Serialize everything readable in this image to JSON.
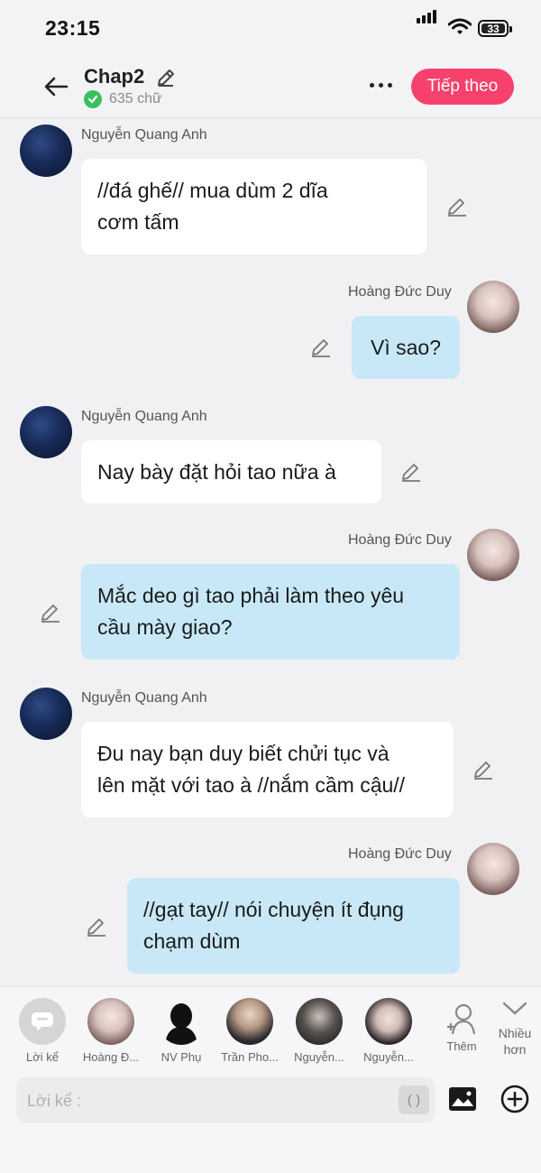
{
  "status_bar": {
    "time": "23:15",
    "battery": "33"
  },
  "header": {
    "title": "Chap2",
    "word_count": "635 chữ",
    "next_label": "Tiếp theo"
  },
  "messages": [
    {
      "sender": "Nguyễn Quang Anh",
      "side": "left",
      "line1": "//đá ghế// mua dùm 2 dĩa",
      "line2": "cơm tấm"
    },
    {
      "sender": "Hoàng Đức Duy",
      "side": "right",
      "line1": "Vì sao?"
    },
    {
      "sender": "Nguyễn Quang Anh",
      "side": "left",
      "line1": "Nay bày đặt hỏi tao nữa à"
    },
    {
      "sender": "Hoàng Đức Duy",
      "side": "right",
      "line1": "Mắc deo gì tao phải làm theo yêu",
      "line2": "cầu mày giao?"
    },
    {
      "sender": "Nguyễn Quang Anh",
      "side": "left",
      "line1": "Đu nay bạn duy biết chửi tục và",
      "line2": "lên mặt với tao à //nắm cầm cậu//"
    },
    {
      "sender": "Hoàng Đức Duy",
      "side": "right",
      "line1": "//gạt tay// nói chuyện ít đụng",
      "line2": "chạm dùm"
    }
  ],
  "characters": {
    "narrator": "Lời kể",
    "c1": "Hoàng Đ...",
    "c2": "NV Phụ",
    "c3": "Trần Pho...",
    "c4": "Nguyễn...",
    "c5": "Nguyễn..."
  },
  "add_label": "Thêm",
  "more_label_1": "Nhiều",
  "more_label_2": "hơn",
  "composer": {
    "placeholder": "Lời kể :",
    "paren": "( )"
  },
  "colors": {
    "accent": "#f5416c",
    "outgoing_bubble": "#c8e8f8",
    "incoming_bubble": "#ffffff",
    "check": "#39c05e"
  }
}
